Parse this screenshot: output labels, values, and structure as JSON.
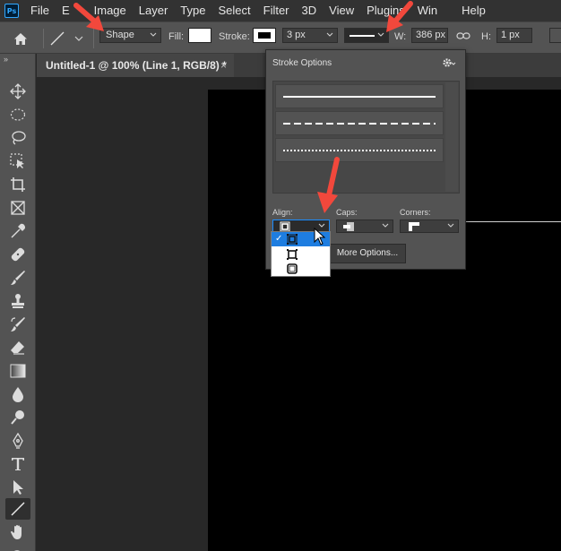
{
  "menubar": {
    "logo": "Ps",
    "items": [
      "File",
      "E",
      "Image",
      "Layer",
      "Type",
      "Select",
      "Filter",
      "3D",
      "View",
      "Plugins",
      "Win",
      "Help"
    ]
  },
  "optionsbar": {
    "mode": "Shape",
    "fill_label": "Fill:",
    "stroke_label": "Stroke:",
    "stroke_width": "3 px",
    "w_label": "W:",
    "w_value": "386 px",
    "h_label": "H:",
    "h_value": "1 px"
  },
  "toolbar": {
    "collapse": "»",
    "tools": [
      "move-icon",
      "marquee-icon",
      "lasso-icon",
      "object-select-icon",
      "crop-icon",
      "frame-icon",
      "eyedropper-icon",
      "healing-icon",
      "brush-icon",
      "stamp-icon",
      "history-brush-icon",
      "eraser-icon",
      "gradient-icon",
      "blur-icon",
      "dodge-icon",
      "pen-icon",
      "type-icon",
      "path-select-icon",
      "line-icon",
      "hand-icon"
    ],
    "active": "line-icon"
  },
  "document": {
    "tab_title": "Untitled-1 @ 100% (Line 1, RGB/8) *",
    "close": "×"
  },
  "stroke_panel": {
    "title": "Stroke Options",
    "gear": "⚙",
    "align_label": "Align:",
    "caps_label": "Caps:",
    "corners_label": "Corners:",
    "more_options": "More Options..."
  },
  "align_dropdown": {
    "options": [
      "inside-icon",
      "center-icon",
      "outside-icon"
    ],
    "selected_index": 0,
    "check": "✓"
  },
  "colors": {
    "annotation": "#f2483c",
    "selection": "#1e7de0"
  }
}
